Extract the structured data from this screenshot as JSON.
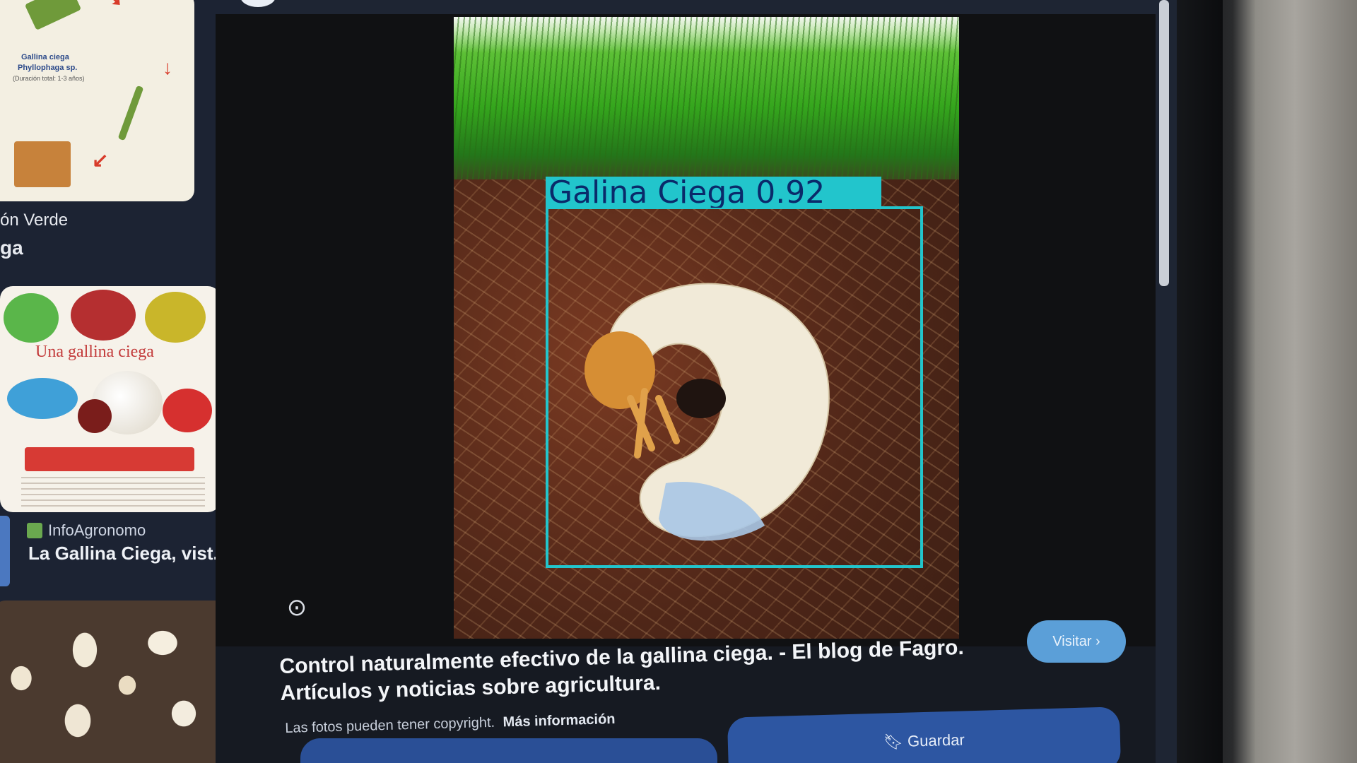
{
  "sidebar": {
    "card1": {
      "title_line1": "Gallina ciega",
      "title_line2": "Phyllophaga sp.",
      "subtitle": "(Duración total: 1-3 años)"
    },
    "labels": {
      "partial1": "ón Verde",
      "partial2": "ga"
    },
    "card2": {
      "headline": "Una gallina ciega",
      "source": "InfoAgronomo",
      "title": "La Gallina Ciega, vist..."
    }
  },
  "viewer": {
    "detection": {
      "label": "Galina Ciega 0.92",
      "confidence": 0.92,
      "box_color": "#22c5cc",
      "label_text_color": "#0a2a6a"
    },
    "lens_icon": "visual-search-icon"
  },
  "info": {
    "description": "Control naturalmente efectivo de la gallina ciega. - El blog de Fagro. Artículos y noticias sobre agricultura.",
    "copyright": "Las fotos pueden tener copyright.",
    "more_info": "Más información",
    "visit_label": "Visitar ›",
    "save_label": "Guardar",
    "accent": "#5b9fd8"
  }
}
